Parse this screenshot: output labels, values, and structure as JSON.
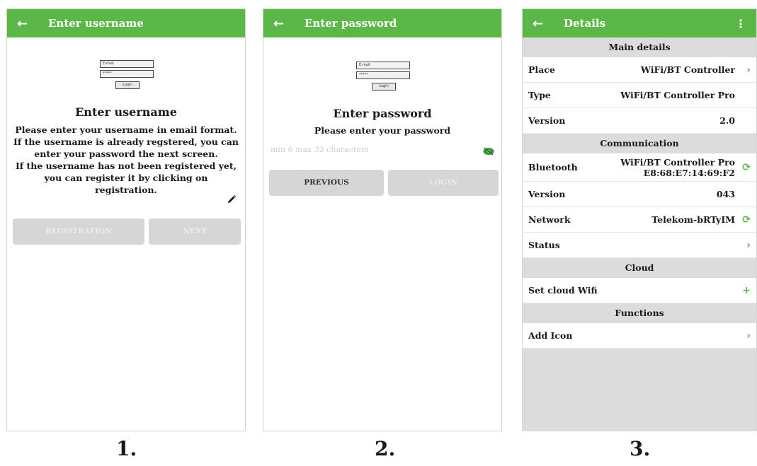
{
  "colors": {
    "accent": "#5bb847",
    "button_bg": "#d6d6d6",
    "section_bg": "#dcdcdc"
  },
  "screen1": {
    "appbar": {
      "back_icon": "arrow-left-icon",
      "title": "Enter username"
    },
    "illustration": {
      "email": "E-mail",
      "password": "*****",
      "login": "Login"
    },
    "heading": "Enter username",
    "lines": [
      "Please enter your username in email format.",
      "If the username is already regstered, you can",
      "enter your password the next screen.",
      "If the username has not been registered yet,",
      "you can register it by clicking on registration."
    ],
    "edit_icon": "pencil-icon",
    "buttons": {
      "left": "REGISTRATION",
      "right": "NEXT"
    }
  },
  "screen2": {
    "appbar": {
      "back_icon": "arrow-left-icon",
      "title": "Enter password"
    },
    "illustration": {
      "email": "E-mail",
      "password": "*****",
      "login": "Login"
    },
    "heading": "Enter password",
    "subheading": "Please enter your password",
    "password_placeholder": "min 6 max 32 characters",
    "eye_icon": "eye-icon",
    "buttons": {
      "previous": "PREVIOUS",
      "login": "LOGIN"
    }
  },
  "screen3": {
    "appbar": {
      "back_icon": "arrow-left-icon",
      "title": "Details",
      "menu_icon": "more-vert-icon"
    },
    "sections": {
      "main": "Main details",
      "communication": "Communication",
      "cloud": "Cloud",
      "functions": "Functions"
    },
    "rows": {
      "place": {
        "label": "Place",
        "value": "WiFi/BT Controller",
        "action": "chevron-right-icon"
      },
      "type": {
        "label": "Type",
        "value": "WiFi/BT Controller Pro"
      },
      "version": {
        "label": "Version",
        "value": "2.0"
      },
      "bluetooth": {
        "label": "Bluetooth",
        "value_line1": "WiFi/BT Controller Pro",
        "value_line2": "E8:68:E7:14:69:F2",
        "action": "refresh-icon"
      },
      "bt_version": {
        "label": "Version",
        "value": "043"
      },
      "network": {
        "label": "Network",
        "value": "Telekom-bRTyIM",
        "action": "refresh-icon"
      },
      "status": {
        "label": "Status",
        "action": "chevron-right-icon"
      },
      "cloud_wifi": {
        "label": "Set cloud Wifi",
        "action": "plus-icon"
      },
      "add_icon": {
        "label": "Add Icon",
        "action": "chevron-right-icon"
      }
    }
  },
  "captions": [
    "1.",
    "2.",
    "3."
  ]
}
